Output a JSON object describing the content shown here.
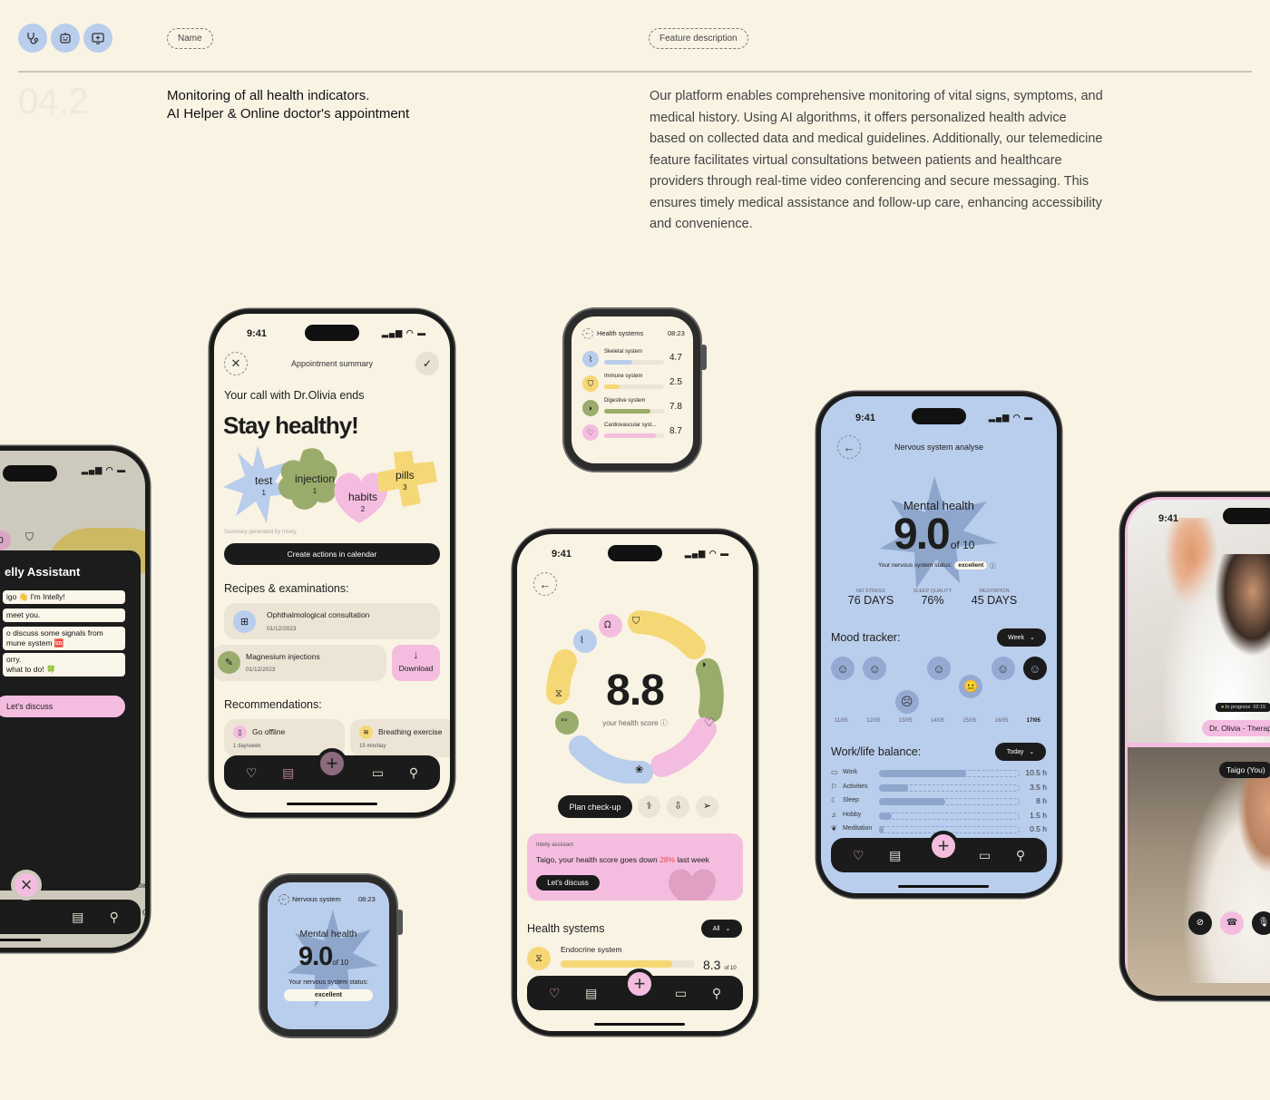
{
  "header": {
    "icons": [
      "stethoscope-icon",
      "robot-icon",
      "monitor-plus-icon"
    ],
    "name_label": "Name",
    "feature_label": "Feature description",
    "section_number": "04.2",
    "title_line1": "Monitoring of all health indicators.",
    "title_line2": "AI Helper & Online doctor's appointment",
    "description": "Our platform enables comprehensive monitoring of vital signs, symptoms, and medical history. Using AI algorithms, it offers personalized health advice based on collected data and medical guidelines. Additionally, our telemedicine feature facilitates virtual consultations between patients and healthcare providers through real-time video conferencing and secure messaging. This ensures timely medical assistance and follow-up care, enhancing accessibility and convenience."
  },
  "colors": {
    "background": "#f9f3e4",
    "blue": "#b9cdec",
    "green": "#9aac6b",
    "pink": "#f4bde0",
    "yellow": "#f5d875",
    "dark": "#1b1b1b",
    "red_accent": "#e84a4a"
  },
  "assistant_phone": {
    "badge_number": "0",
    "title": "elly Assistant",
    "messages": [
      "igo 👋 I'm Intelly!",
      " meet you.",
      "o discuss some signals from\nmune system 🆘",
      "orry.\nwhat to do! 🍀"
    ],
    "action_label": "Let's discuss",
    "close_icon": "×",
    "peek_text_1": "ste",
    "peek_text_2": "Go"
  },
  "appointment_phone": {
    "time": "9:41",
    "header_title": "Appointment summary",
    "subtitle": "Your call with Dr.Olivia ends",
    "headline": "Stay healthy!",
    "shapes": [
      {
        "label": "test",
        "count": "1"
      },
      {
        "label": "injection",
        "count": "1"
      },
      {
        "label": "habits",
        "count": "2"
      },
      {
        "label": "pills",
        "count": "3"
      }
    ],
    "generated_note": "Summary generated by Intelly",
    "calendar_button": "Create actions in calendar",
    "recipes_title": "Recipes & examinations:",
    "recipes": [
      {
        "name": "Ophthalmological consultation",
        "date": "01/12/2023"
      },
      {
        "name": "Magnesium injections",
        "date": "01/12/2023"
      }
    ],
    "download_label": "Download",
    "recommendations_title": "Recommendations:",
    "recommendations": [
      {
        "name": "Go offline",
        "freq": "1 day/week"
      },
      {
        "name": "Breathing exercise",
        "freq": "15 min/day"
      }
    ]
  },
  "watch_health": {
    "title": "Health systems",
    "time": "08:23",
    "systems": [
      {
        "name": "Skeletal system",
        "value": "4.7",
        "score": 4.7
      },
      {
        "name": "Immune system",
        "value": "2.5",
        "score": 2.5
      },
      {
        "name": "Digestive system",
        "value": "7.8",
        "score": 7.8
      },
      {
        "name": "Cardiovascular syst...",
        "value": "8.7",
        "score": 8.7
      }
    ]
  },
  "score_phone": {
    "time": "9:41",
    "score": "8.8",
    "score_label": "your health score",
    "plan_button": "Plan check-up",
    "assistant_label": "Intelly assistant",
    "alert_prefix": "Taigo, your health score goes down ",
    "alert_percent": "28%",
    "alert_suffix": " last week",
    "discuss_button": "Let's discuss",
    "systems_title": "Health systems",
    "filter": "All",
    "endocrine_name": "Endocrine system",
    "endocrine_value": "8.3",
    "endocrine_score": 8.3,
    "of_ten": "of 10"
  },
  "watch_nervous": {
    "title": "Nervous system",
    "time": "08:23",
    "heading": "Mental health",
    "score": "9.0",
    "of_ten": "of 10",
    "status_label": "Your nervous system status:",
    "status": "excellent"
  },
  "nervous_phone": {
    "time": "9:41",
    "header_title": "Nervous system analyse",
    "heading": "Mental health",
    "score": "9.0",
    "of_ten": "of 10",
    "status_label": "Your nervous system status:",
    "status": "excellent",
    "stats": [
      {
        "label": "NO STRESS",
        "value": "76 DAYS"
      },
      {
        "label": "SLEEP QUALITY",
        "value": "76%"
      },
      {
        "label": "MEDITATION",
        "value": "45 DAYS"
      }
    ],
    "mood_title": "Mood tracker:",
    "mood_filter": "Week",
    "moods": [
      {
        "date": "11/05",
        "mood": "happy"
      },
      {
        "date": "12/05",
        "mood": "happy"
      },
      {
        "date": "13/05",
        "mood": "sad"
      },
      {
        "date": "14/05",
        "mood": "happy"
      },
      {
        "date": "15/05",
        "mood": "neutral"
      },
      {
        "date": "16/05",
        "mood": "happy"
      },
      {
        "date": "17/05",
        "mood": "happy"
      }
    ],
    "balance_title": "Work/life balance:",
    "balance_filter": "Today",
    "balance": [
      {
        "name": "Work",
        "value": "10.5 h",
        "hours": 10.5
      },
      {
        "name": "Activities",
        "value": "3.5 h",
        "hours": 3.5
      },
      {
        "name": "Sleep",
        "value": "8 h",
        "hours": 8
      },
      {
        "name": "Hobby",
        "value": "1.5 h",
        "hours": 1.5
      },
      {
        "name": "Meditation",
        "value": "0.5 h",
        "hours": 0.5
      }
    ]
  },
  "video_phone": {
    "time": "9:41",
    "call_status": "In progress",
    "call_duration": "02:15",
    "doctor_label": "Dr. Olivia - Therapist",
    "self_label": "Taigo (You)"
  }
}
